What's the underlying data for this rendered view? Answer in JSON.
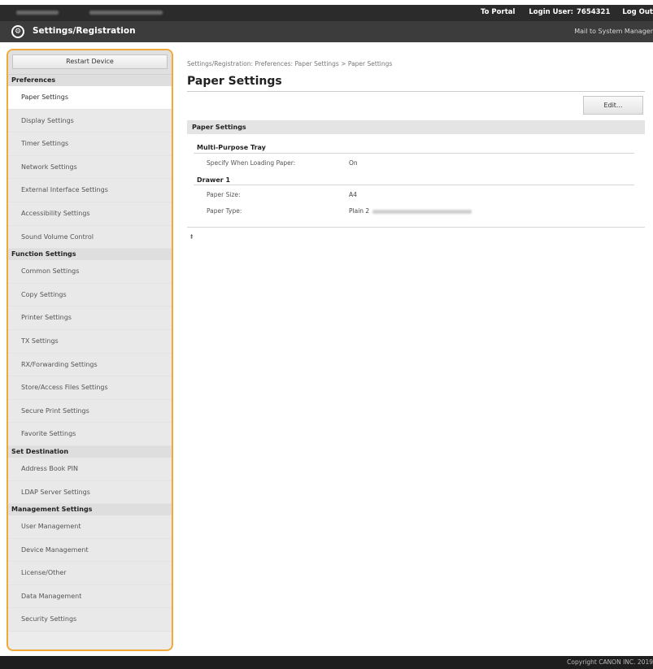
{
  "topbar": {
    "portal": "To Portal",
    "login_label": "Login User:",
    "login_user": "7654321",
    "logout": "Log Out"
  },
  "header": {
    "title": "Settings/Registration",
    "mail": "Mail to System Manager"
  },
  "sidebar": {
    "restart": "Restart Device",
    "sections": [
      {
        "title": "Preferences",
        "items": [
          "Paper Settings",
          "Display Settings",
          "Timer Settings",
          "Network Settings",
          "External Interface Settings",
          "Accessibility Settings",
          "Sound Volume Control"
        ]
      },
      {
        "title": "Function Settings",
        "items": [
          "Common Settings",
          "Copy Settings",
          "Printer Settings",
          "TX Settings",
          "RX/Forwarding Settings",
          "Store/Access Files Settings",
          "Secure Print Settings",
          "Favorite Settings"
        ]
      },
      {
        "title": "Set Destination",
        "items": [
          "Address Book PIN",
          "LDAP Server Settings"
        ]
      },
      {
        "title": "Management Settings",
        "items": [
          "User Management",
          "Device Management",
          "License/Other",
          "Data Management",
          "Security Settings"
        ]
      }
    ]
  },
  "main": {
    "breadcrumb": "Settings/Registration: Preferences: Paper Settings > Paper Settings",
    "title": "Paper Settings",
    "edit": "Edit...",
    "section": "Paper Settings",
    "mp_tray": "Multi-Purpose Tray",
    "mp_label": "Specify When Loading Paper:",
    "mp_value": "On",
    "drawer": "Drawer 1",
    "size_label": "Paper Size:",
    "size_value": "A4",
    "type_label": "Paper Type:",
    "type_value": "Plain 2",
    "top_icon": "to-top-icon"
  },
  "footer": {
    "copyright": "Copyright CANON INC. 2019"
  }
}
